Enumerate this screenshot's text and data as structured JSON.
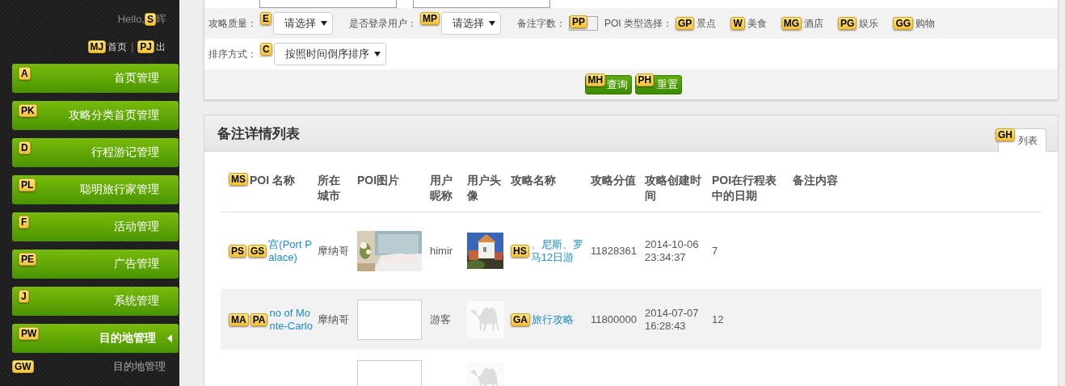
{
  "sidebar": {
    "greeting": {
      "text": "Hello,",
      "hint": "S",
      "name": "晖"
    },
    "separator": "|",
    "links": [
      {
        "hint": "MJ",
        "label": "首页"
      },
      {
        "hint": "PJ",
        "label": "出"
      }
    ],
    "items": [
      {
        "hint": "A",
        "label": "首页管理",
        "expanded": false
      },
      {
        "hint": "PK",
        "label": "攻略分类首页管理",
        "expanded": false
      },
      {
        "hint": "D",
        "label": "行程游记管理",
        "expanded": false
      },
      {
        "hint": "PL",
        "label": "聪明旅行家管理",
        "expanded": false
      },
      {
        "hint": "F",
        "label": "活动管理",
        "expanded": false
      },
      {
        "hint": "PE",
        "label": "广告管理",
        "expanded": false
      },
      {
        "hint": "J",
        "label": "系统管理",
        "expanded": false
      },
      {
        "hint": "PW",
        "label": "目的地管理",
        "expanded": true,
        "children": [
          {
            "hint": "GW",
            "label": "目的地管理"
          }
        ]
      }
    ]
  },
  "filters": {
    "row1": [
      {
        "kind": "select",
        "label": "攻略质量：",
        "hint": "E",
        "value": "请选择"
      },
      {
        "kind": "select",
        "label": "是否登录用户：",
        "hint": "MP",
        "value": "请选择"
      },
      {
        "kind": "input",
        "label": "备注字数：",
        "hint": "PP"
      },
      {
        "kind": "checks",
        "label": "POI 类型选择：",
        "options": [
          {
            "hint": "GP",
            "label": "景点"
          },
          {
            "hint": "W",
            "label": "美食"
          },
          {
            "hint": "MG",
            "label": "酒店"
          },
          {
            "hint": "PG",
            "label": "娱乐"
          },
          {
            "hint": "GG",
            "label": "购物"
          }
        ]
      }
    ],
    "row2": [
      {
        "kind": "select",
        "label": "排序方式：",
        "hint": "C",
        "value": "按照时间倒序排序"
      }
    ],
    "buttons": [
      {
        "hint": "MH",
        "label": "查询"
      },
      {
        "hint": "PH",
        "label": "重置"
      }
    ]
  },
  "list": {
    "title": "备注详情列表",
    "tabs": [
      {
        "hint": "GH",
        "label": "列表",
        "selected": true
      }
    ],
    "columns": [
      {
        "hint": "MS",
        "label": "POI 名称"
      },
      {
        "label": "所在城市"
      },
      {
        "label": "POI图片"
      },
      {
        "label": "用户昵称"
      },
      {
        "label": "用户头像"
      },
      {
        "label": "攻略名称"
      },
      {
        "label": "攻略分值"
      },
      {
        "label": "攻略创建时间"
      },
      {
        "label": "POI在行程表中的日期"
      },
      {
        "label": "备注内容"
      }
    ],
    "rows": [
      {
        "hints": [
          "PS",
          "GS"
        ],
        "poi_name": "宫(Port Palace)",
        "city": "摩纳哥",
        "poi_image": {
          "kind": "picture"
        },
        "nickname": "himir",
        "avatar": {
          "kind": "picture"
        },
        "guide_hint": "HS",
        "guide": "、尼斯、罗马12日游",
        "score": "11828361",
        "created": "2014-10-06 23:34:37",
        "day": "7"
      },
      {
        "hints": [
          "MA",
          "PA"
        ],
        "poi_name": "no of Monte-Carlo",
        "city": "摩纳哥",
        "poi_image": {
          "kind": "empty"
        },
        "nickname": "游客",
        "avatar": {
          "kind": "icon"
        },
        "guide_hint": "GA",
        "guide": "旅行攻略",
        "score": "11800000",
        "created": "2014-07-07 16:28:43",
        "day": "12"
      },
      {
        "poi_image": {
          "kind": "empty"
        },
        "avatar": {
          "kind": "icon"
        }
      }
    ]
  }
}
